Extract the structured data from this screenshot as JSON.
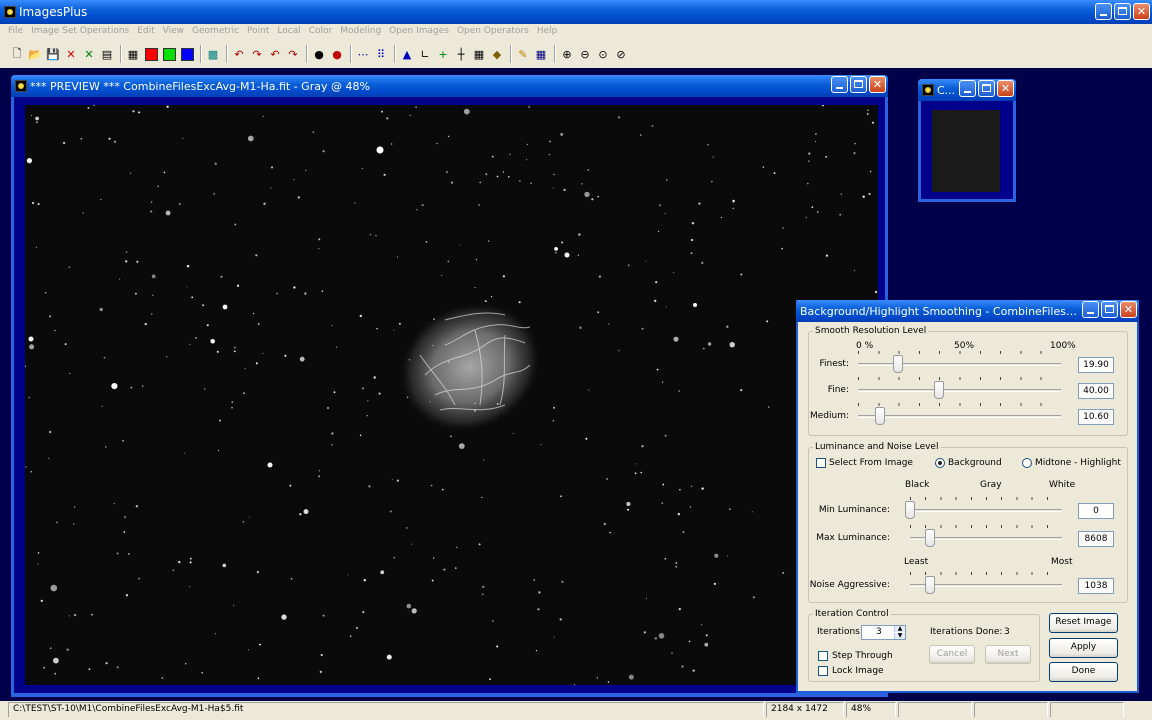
{
  "app": {
    "title": "ImagesPlus"
  },
  "menu": [
    "File",
    "Image Set Operations",
    "Edit",
    "View",
    "Geometric",
    "Point",
    "Local",
    "Color",
    "Modeling",
    "Open Images",
    "Open Operators",
    "Help"
  ],
  "toolbar": {
    "icons": [
      "new-icon",
      "open-icon",
      "save-icon",
      "close-red-icon",
      "close-green-icon",
      "print-icon",
      "sep",
      "rgb-icon",
      "red-swatch",
      "green-swatch",
      "blue-swatch",
      "sep",
      "grid-icon",
      "sep",
      "undo-icon",
      "redo-icon",
      "undo-all-icon",
      "redo-all-icon",
      "sep",
      "point-icon",
      "point-red-icon",
      "sep",
      "dots-icon",
      "select-icon",
      "sep",
      "histogram-icon",
      "curves-icon",
      "add-icon",
      "crosshair-icon",
      "grid-small-icon",
      "color-icon",
      "sep",
      "pencil-icon",
      "table-icon",
      "sep",
      "zoom-in-icon",
      "zoom-out-icon",
      "zoom-fit-icon",
      "zoom-reset-icon"
    ],
    "colors": {
      "red": "#ff0000",
      "green": "#00e000",
      "blue": "#0000ff"
    }
  },
  "preview_window": {
    "title": "*** PREVIEW *** CombineFilesExcAvg-M1-Ha.fit - Gray @ 48%"
  },
  "mini_window": {
    "title": "C..."
  },
  "dialog": {
    "title": "Background/Highlight Smoothing - CombineFilesExcAv...",
    "smooth": {
      "group": "Smooth Resolution Level",
      "scale": [
        "0 %",
        "50%",
        "100%"
      ],
      "rows": [
        {
          "label": "Finest:",
          "value": "19.90",
          "level": 0.199
        },
        {
          "label": "Fine:",
          "value": "40.00",
          "level": 0.4
        },
        {
          "label": "Medium:",
          "value": "10.60",
          "level": 0.106
        }
      ]
    },
    "luminance": {
      "group": "Luminance and Noise Level",
      "select_from_image": "Select From Image",
      "background": "Background",
      "midtone": "Midtone - Highlight",
      "scale": [
        "Black",
        "Gray",
        "White"
      ],
      "scale2": [
        "Least",
        "Most"
      ],
      "rows": [
        {
          "label": "Min Luminance:",
          "value": "0",
          "level": 0.0
        },
        {
          "label": "Max Luminance:",
          "value": "8608",
          "level": 0.131
        },
        {
          "label": "Noise Aggressive:",
          "value": "1038",
          "level": 0.13
        }
      ]
    },
    "iteration": {
      "group": "Iteration Control",
      "iterations_label": "Iterations:",
      "iterations_value": "3",
      "done_label": "Iterations Done:",
      "done_value": "3",
      "cancel": "Cancel",
      "next": "Next",
      "step_through": "Step Through",
      "lock_image": "Lock Image"
    },
    "buttons": {
      "reset": "Reset Image",
      "apply": "Apply",
      "done": "Done"
    }
  },
  "status": {
    "path": "C:\\TEST\\ST-10\\M1\\CombineFilesExcAvg-M1-Ha$5.fit",
    "size": "2184 x 1472",
    "zoom": "48%"
  }
}
